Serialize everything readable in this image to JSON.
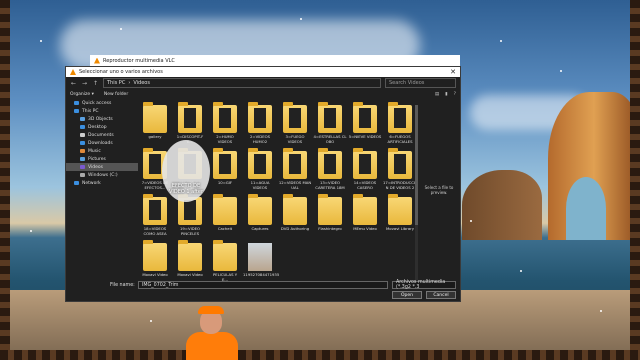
{
  "player": {
    "title": "Reproductor multimedia VLC"
  },
  "dialog": {
    "title": "Seleccionar uno o varios archivos",
    "address": [
      "This PC",
      "Videos"
    ],
    "search_placeholder": "Search Videos",
    "toolbar": {
      "organize": "Organize ▾",
      "new_folder": "New folder"
    },
    "sidebar": [
      {
        "label": "Quick access",
        "icon": "star-icon",
        "sub": false,
        "selected": false
      },
      {
        "label": "This PC",
        "icon": "computer-icon",
        "sub": false,
        "selected": false
      },
      {
        "label": "3D Objects",
        "icon": "cube-icon",
        "sub": true,
        "selected": false
      },
      {
        "label": "Desktop",
        "icon": "desktop-icon",
        "sub": true,
        "selected": false
      },
      {
        "label": "Documents",
        "icon": "documents-icon",
        "sub": true,
        "selected": false
      },
      {
        "label": "Downloads",
        "icon": "download-icon",
        "sub": true,
        "selected": false
      },
      {
        "label": "Music",
        "icon": "music-icon",
        "sub": true,
        "selected": false
      },
      {
        "label": "Pictures",
        "icon": "pictures-icon",
        "sub": true,
        "selected": false
      },
      {
        "label": "Videos",
        "icon": "video-icon",
        "sub": true,
        "selected": true
      },
      {
        "label": "Windows (C:)",
        "icon": "drive-icon",
        "sub": true,
        "selected": false
      },
      {
        "label": "Network",
        "icon": "network-icon",
        "sub": false,
        "selected": false
      }
    ],
    "files": [
      {
        "name": "gallery",
        "kind": "folder",
        "thumb": false
      },
      {
        "name": "1=DISCOPIT-F\nE...",
        "kind": "folder",
        "thumb": true
      },
      {
        "name": "2=HUMO\nVIDEOS",
        "kind": "folder",
        "thumb": true
      },
      {
        "name": "2=VIDEOS\nHUMO2",
        "kind": "folder",
        "thumb": true
      },
      {
        "name": "3=FUEGO\nVIDEOS",
        "kind": "folder",
        "thumb": true
      },
      {
        "name": "4=ESTRELLAS CL\nOBO",
        "kind": "folder",
        "thumb": true
      },
      {
        "name": "5=NIEVE VIDEOS",
        "kind": "folder",
        "thumb": true
      },
      {
        "name": "6=FUEGOS\nARTIFICIALES",
        "kind": "folder",
        "thumb": true
      },
      {
        "name": "7=VIDEOS DE\nEFECTOS...",
        "kind": "folder",
        "thumb": true
      },
      {
        "name": "EFECTO DE\nVIDEO",
        "kind": "folder",
        "thumb": true
      },
      {
        "name": "10=GIF",
        "kind": "folder",
        "thumb": true
      },
      {
        "name": "11=AGUA\nVIDEOS",
        "kind": "folder",
        "thumb": true
      },
      {
        "name": "12=VIDEOS MAN\nUAL",
        "kind": "folder",
        "thumb": true
      },
      {
        "name": "13=VIDEO\nCARETERA 18M",
        "kind": "folder",
        "thumb": true
      },
      {
        "name": "14=VIDEOS\nCASERO",
        "kind": "folder",
        "thumb": true
      },
      {
        "name": "17=INTRODUCCIO\nN DE VIDEOS 2",
        "kind": "folder",
        "thumb": true
      },
      {
        "name": "18=VIDEOS\nCOMO ASEA",
        "kind": "folder",
        "thumb": true
      },
      {
        "name": "19=VIDEO\nPINCELES",
        "kind": "folder",
        "thumb": true
      },
      {
        "name": "Cacheit",
        "kind": "folder",
        "thumb": false
      },
      {
        "name": "Captures",
        "kind": "folder",
        "thumb": false
      },
      {
        "name": "DVD Authoring",
        "kind": "folder",
        "thumb": false
      },
      {
        "name": "Flashintegro",
        "kind": "folder",
        "thumb": false
      },
      {
        "name": "MEmu Video",
        "kind": "folder",
        "thumb": false
      },
      {
        "name": "Movavi Library",
        "kind": "folder",
        "thumb": false
      },
      {
        "name": "Movavi Video",
        "kind": "folder",
        "thumb": false
      },
      {
        "name": "Movavi Video",
        "kind": "folder",
        "thumb": false
      },
      {
        "name": "PELICULAS Y\nE...",
        "kind": "folder",
        "thumb": false
      },
      {
        "name": "119527084471935",
        "kind": "image",
        "thumb": false
      }
    ],
    "hover_label": "EFECTO DE\nVIDEO 1 after",
    "preview_text": "Select a file to preview.",
    "file_name_label": "File name:",
    "file_name_value": "IMG_0702_Trim",
    "file_type": "Archivos multimedia (*.3g2 *.3",
    "open_label": "Open",
    "cancel_label": "Cancel",
    "close_glyph": "✕"
  }
}
